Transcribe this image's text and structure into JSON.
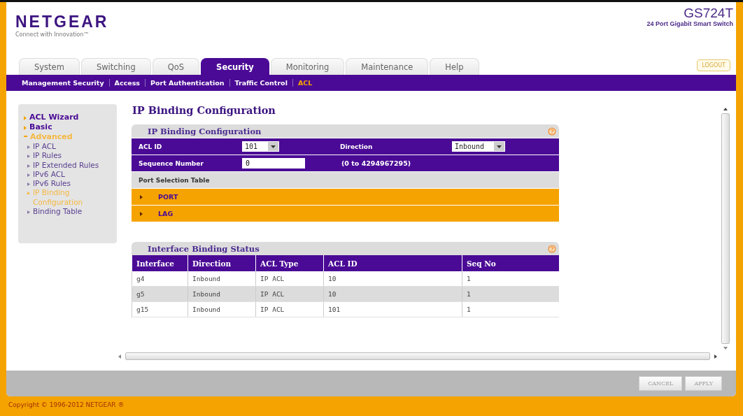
{
  "header": {
    "logo": "NETGEAR",
    "tagline": "Connect with Innovation™",
    "model": "GS724T",
    "model_description": "24 Port Gigabit Smart Switch",
    "logout": "LOGOUT"
  },
  "tabs": [
    {
      "label": "System",
      "selected": false
    },
    {
      "label": "Switching",
      "selected": false
    },
    {
      "label": "QoS",
      "selected": false
    },
    {
      "label": "Security",
      "selected": true
    },
    {
      "label": "Monitoring",
      "selected": false
    },
    {
      "label": "Maintenance",
      "selected": false
    },
    {
      "label": "Help",
      "selected": false
    }
  ],
  "subnav": [
    {
      "label": "Management Security",
      "selected": false
    },
    {
      "label": "Access",
      "selected": false
    },
    {
      "label": "Port Authentication",
      "selected": false
    },
    {
      "label": "Traffic Control",
      "selected": false
    },
    {
      "label": "ACL",
      "selected": true
    }
  ],
  "sidebar": {
    "items": [
      {
        "label": "ACL Wizard",
        "selected": false,
        "expanded": false
      },
      {
        "label": "Basic",
        "selected": false,
        "expanded": false
      },
      {
        "label": "Advanced",
        "selected": true,
        "expanded": true,
        "children": [
          {
            "label": "IP ACL",
            "selected": false
          },
          {
            "label": "IP Rules",
            "selected": false
          },
          {
            "label": "IP Extended Rules",
            "selected": false
          },
          {
            "label": "IPv6 ACL",
            "selected": false
          },
          {
            "label": "IPv6 Rules",
            "selected": false
          },
          {
            "label": "IP Binding Configuration",
            "selected": true
          },
          {
            "label": "Binding Table",
            "selected": false
          }
        ]
      }
    ]
  },
  "page_title": "IP Binding Configuration",
  "config_panel": {
    "title": "IP Binding Configuration",
    "acl_id": {
      "label": "ACL ID",
      "value": "101"
    },
    "direction": {
      "label": "Direction",
      "value": "Inbound"
    },
    "sequence_number": {
      "label": "Sequence Number",
      "value": "0",
      "hint": "(0 to 4294967295)"
    },
    "port_selection_table": {
      "title": "Port Selection Table",
      "rows": [
        {
          "label": "PORT",
          "expanded": false
        },
        {
          "label": "LAG",
          "expanded": false
        }
      ]
    }
  },
  "status_panel": {
    "title": "Interface Binding Status",
    "columns": [
      "Interface",
      "Direction",
      "ACL Type",
      "ACL ID",
      "Seq No"
    ],
    "rows": [
      [
        "g4",
        "Inbound",
        "IP ACL",
        "10",
        "1"
      ],
      [
        "g5",
        "Inbound",
        "IP ACL",
        "10",
        "1"
      ],
      [
        "g15",
        "Inbound",
        "IP ACL",
        "101",
        "1"
      ]
    ]
  },
  "buttons": [
    "CANCEL",
    "APPLY"
  ],
  "copyright": "Copyright © 1996-2012 NETGEAR ®"
}
